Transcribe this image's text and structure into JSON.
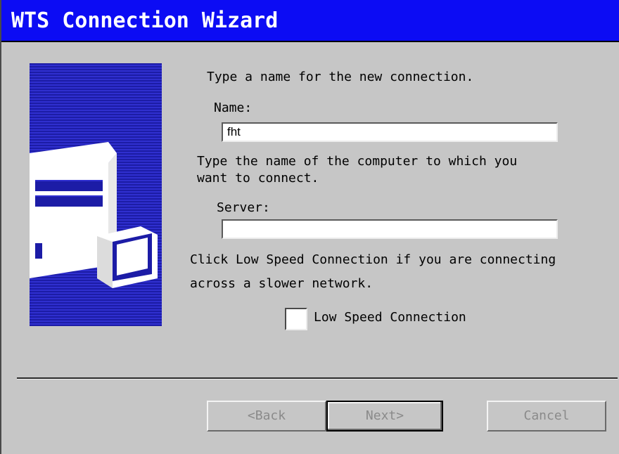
{
  "window": {
    "title": "WTS Connection Wizard"
  },
  "banner": {
    "icon": "computer-server-icon"
  },
  "name_section": {
    "instruction": "Type a name for the new connection.",
    "label": "Name:",
    "value": "fht"
  },
  "server_section": {
    "instruction_line1": "Type the name of the computer to which you",
    "instruction_line2": "want to connect.",
    "label": "Server:",
    "value": ""
  },
  "speed_section": {
    "instruction_line1": "Click Low Speed Connection if you are connecting",
    "instruction_line2": "across a slower network.",
    "checkbox_label": "Low Speed Connection",
    "checked": false
  },
  "buttons": {
    "back": "<Back",
    "next": "Next>",
    "cancel": "Cancel"
  },
  "colors": {
    "titlebar": "#0c0cf4",
    "banner": "#2f2fcf",
    "background": "#c6c6c6",
    "disabled_text": "#8a8a8a"
  }
}
